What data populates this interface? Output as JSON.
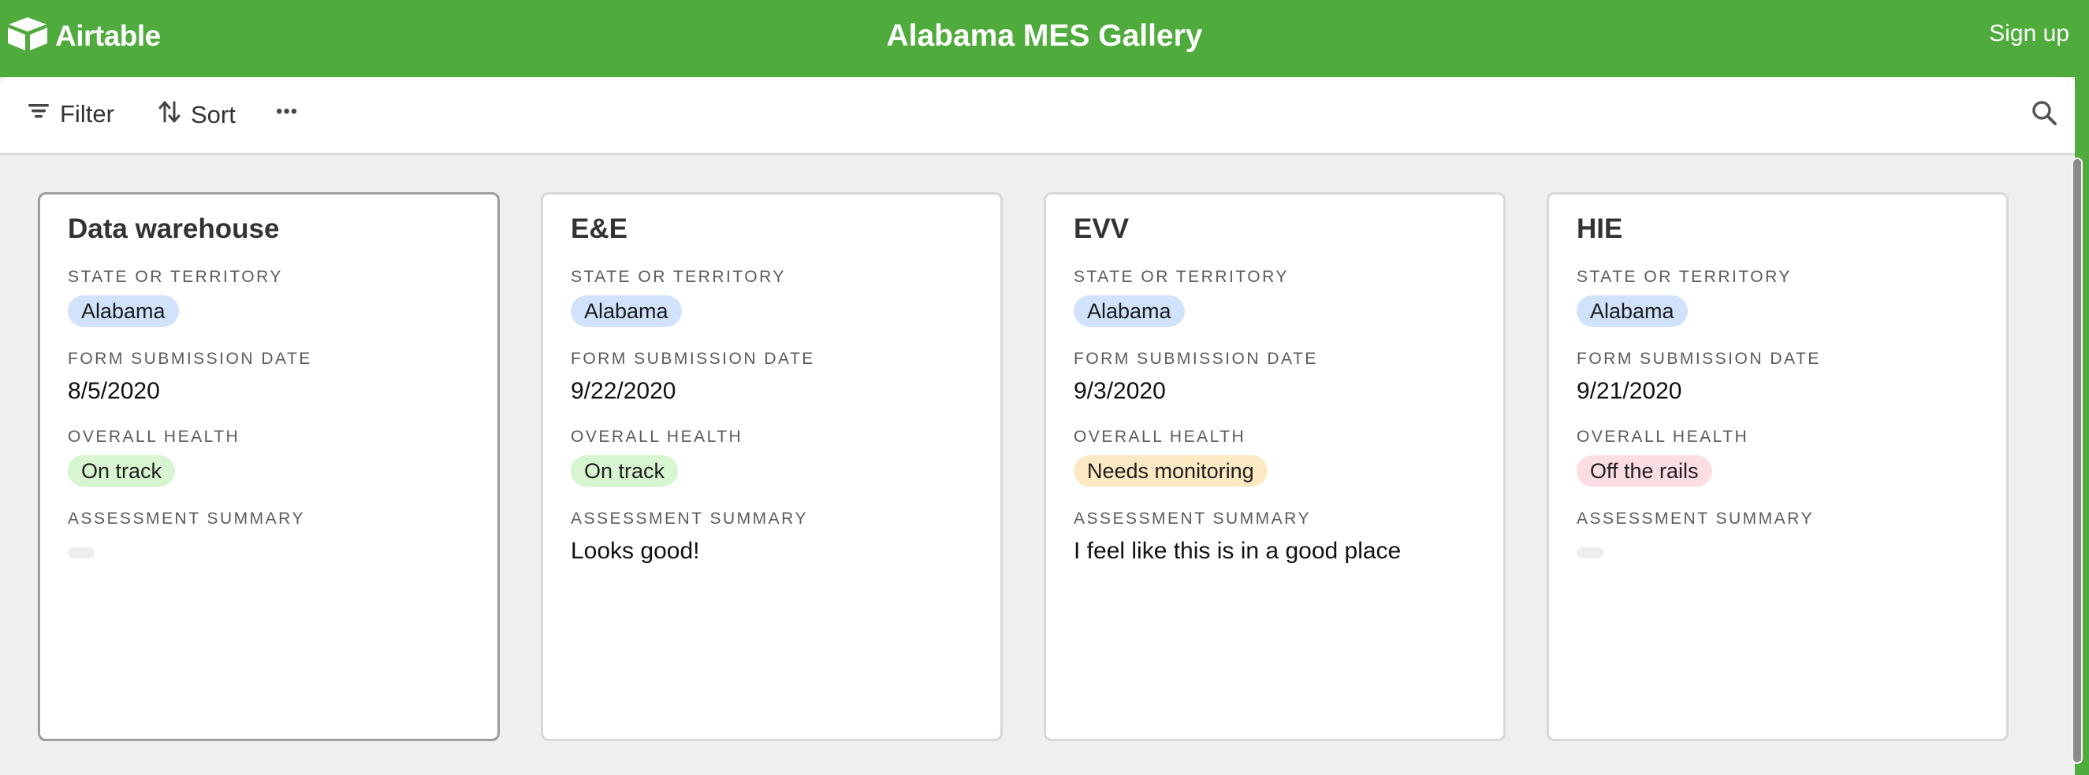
{
  "app": {
    "logo_text": "Airtable",
    "title": "Alabama MES Gallery",
    "signup_label": "Sign up"
  },
  "toolbar": {
    "filter_label": "Filter",
    "sort_label": "Sort",
    "more_label": "•••"
  },
  "colors": {
    "brand_green": "#4fab3c",
    "state_pill": "#d1e2fb",
    "on_track": "#d6f5d0",
    "needs_monitoring": "#fde9c3",
    "off_the_rails": "#fcdde3"
  },
  "icons": {
    "logo": "airtable-logo-icon",
    "filter": "filter-icon",
    "sort": "sort-icon",
    "more": "more-icon",
    "search": "search-icon"
  },
  "field_labels": {
    "state": "STATE OR TERRITORY",
    "date": "FORM SUBMISSION DATE",
    "health": "OVERALL HEALTH",
    "summary": "ASSESSMENT SUMMARY"
  },
  "cards": [
    {
      "title": "Data warehouse",
      "state": "Alabama",
      "date": "8/5/2020",
      "health": "On track",
      "health_color": "#d6f5d0",
      "summary": ""
    },
    {
      "title": "E&E",
      "state": "Alabama",
      "date": "9/22/2020",
      "health": "On track",
      "health_color": "#d6f5d0",
      "summary": "Looks good!"
    },
    {
      "title": "EVV",
      "state": "Alabama",
      "date": "9/3/2020",
      "health": "Needs monitoring",
      "health_color": "#fde9c3",
      "summary": "I feel like this is in a good place"
    },
    {
      "title": "HIE",
      "state": "Alabama",
      "date": "9/21/2020",
      "health": "Off the rails",
      "health_color": "#fcdde3",
      "summary": ""
    }
  ]
}
